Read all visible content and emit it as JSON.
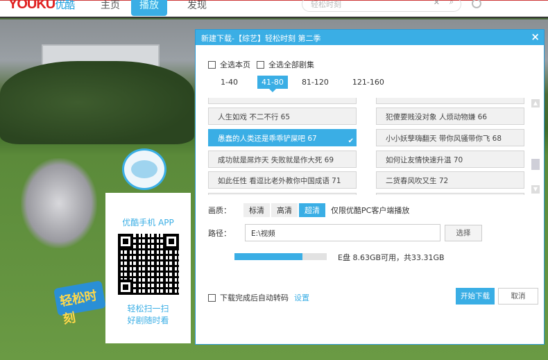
{
  "header": {
    "logo": "YOUKU",
    "logo_cn": "优酷",
    "nav": [
      "主页",
      "播放",
      "发现"
    ],
    "active_nav": 1,
    "search_placeholder": "轻松时刻"
  },
  "promo": {
    "app_title": "优酷手机 APP",
    "line1": "轻松扫一扫",
    "line2": "好剧随时看",
    "badge": "轻松时刻"
  },
  "dialog": {
    "title": "新建下载-【综艺】轻松时刻 第二季",
    "select_page": "全选本页",
    "select_all": "全选全部剧集",
    "tabs": [
      "1-40",
      "41-80",
      "81-120",
      "121-160"
    ],
    "active_tab": 1,
    "episodes": [
      {
        "title": "人生如戏 不二不行 65",
        "selected": false
      },
      {
        "title": "犯傻要贱没对象 人烦动物嫌 66",
        "selected": false
      },
      {
        "title": "愚蠢的人类还是乖乖铲屎吧 67",
        "selected": true
      },
      {
        "title": "小小妖孽嗨翻天 带你风骚带你飞 68",
        "selected": false
      },
      {
        "title": "成功就是屌炸天 失败就是作大死 69",
        "selected": false
      },
      {
        "title": "如何让友情快速升温 70",
        "selected": false
      },
      {
        "title": "如此任性 看逗比老外教你中国成语 71",
        "selected": false
      },
      {
        "title": "二货春风吹又生 72",
        "selected": false
      }
    ],
    "quality_label": "画质：",
    "quality": [
      "标清",
      "高清",
      "超清"
    ],
    "active_quality": 2,
    "quality_note": "仅限优酷PC客户端播放",
    "path_label": "路径：",
    "path": "E:\\视频",
    "choose": "选择",
    "disk_used_percent": 74,
    "disk_text": "E盘 8.63GB可用，共33.31GB",
    "auto_transcode": "下载完成后自动转码",
    "settings": "设置",
    "start": "开始下载",
    "cancel": "取消",
    "accent": "#3aaee5"
  }
}
